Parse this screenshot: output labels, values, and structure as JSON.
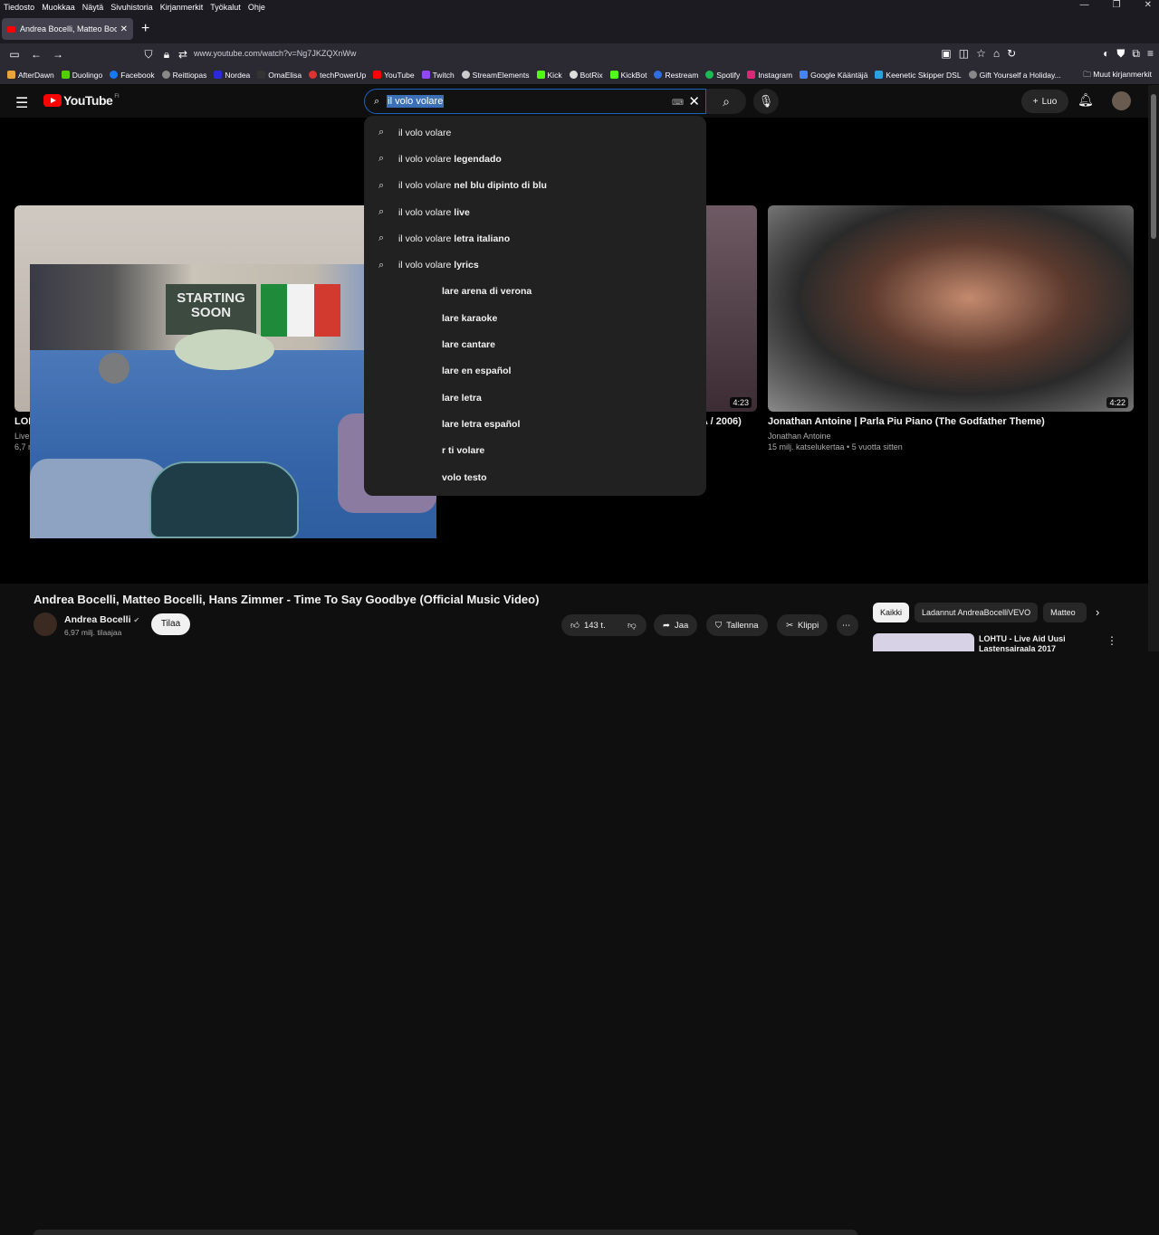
{
  "menubar": [
    "Tiedosto",
    "Muokkaa",
    "Näytä",
    "Sivuhistoria",
    "Kirjanmerkit",
    "Työkalut",
    "Ohje"
  ],
  "tab": {
    "title": "Andrea Bocelli, Matteo Bocelli, "
  },
  "url": "www.youtube.com/watch?v=Ng7JKZQXnWw",
  "bookmarks": [
    "AfterDawn",
    "Duolingo",
    "Facebook",
    "Reittiopas",
    "Nordea",
    "OmaElisa",
    "techPowerUp",
    "YouTube",
    "Twitch",
    "StreamElements",
    "Kick",
    "BotRix",
    "KickBot",
    "Restream",
    "Spotify",
    "Instagram",
    "Google Kääntäjä",
    "Keenetic Skipper DSL",
    "Gift Yourself a Holiday..."
  ],
  "bookmarks_other": "Muut kirjanmerkit",
  "yt": {
    "logo": "YouTube",
    "logo_cc": "FI",
    "search_value": "il volo volare",
    "create_label": "Luo"
  },
  "suggestions": [
    {
      "base": "il volo volare",
      "rest": ""
    },
    {
      "base": "il volo volare ",
      "rest": "legendado"
    },
    {
      "base": "il volo volare ",
      "rest": "nel blu dipinto di blu"
    },
    {
      "base": "il volo volare ",
      "rest": "live"
    },
    {
      "base": "il volo volare ",
      "rest": "letra italiano"
    },
    {
      "base": "il volo volare ",
      "rest": "lyrics"
    },
    {
      "base": "",
      "rest": "lare arena di verona"
    },
    {
      "base": "",
      "rest": "lare karaoke"
    },
    {
      "base": "",
      "rest": "lare cantare"
    },
    {
      "base": "",
      "rest": "lare en español"
    },
    {
      "base": "",
      "rest": "lare letra"
    },
    {
      "base": "",
      "rest": "lare letra español"
    },
    {
      "base": "",
      "rest": "r ti volare"
    },
    {
      "base": "",
      "rest": "volo testo"
    }
  ],
  "cards": [
    {
      "title": "LOH",
      "meta1": "Live",
      "meta2": "6,7 n"
    },
    {
      "title": "A / 2006)",
      "duration": "4:23"
    },
    {
      "title": "Jonathan Antoine | Parla Piu Piano (The Godfather Theme)",
      "channel": "Jonathan Antoine",
      "meta": "15 milj. katselukertaa • 5 vuotta sitten",
      "duration": "4:22"
    }
  ],
  "overlay": {
    "sign_text": "STARTING SOON"
  },
  "video": {
    "title": "Andrea Bocelli, Matteo Bocelli, Hans Zimmer - Time To Say Goodbye (Official Music Video)",
    "channel": "Andrea Bocelli",
    "subscribers": "6,97 milj. tilaajaa",
    "subscribe_label": "Tilaa",
    "likes": "143 t.",
    "share_label": "Jaa",
    "save_label": "Tallenna",
    "clip_label": "Klippi"
  },
  "chips": [
    "Kaikki",
    "Ladannut AndreaBocelliVEVO",
    "Matteo"
  ],
  "rec": {
    "title": "LOHTU - Live Aid Uusi Lastensairaala 2017"
  },
  "colors": {
    "accent": "#ff0000",
    "search_focus": "#1c62b9"
  }
}
